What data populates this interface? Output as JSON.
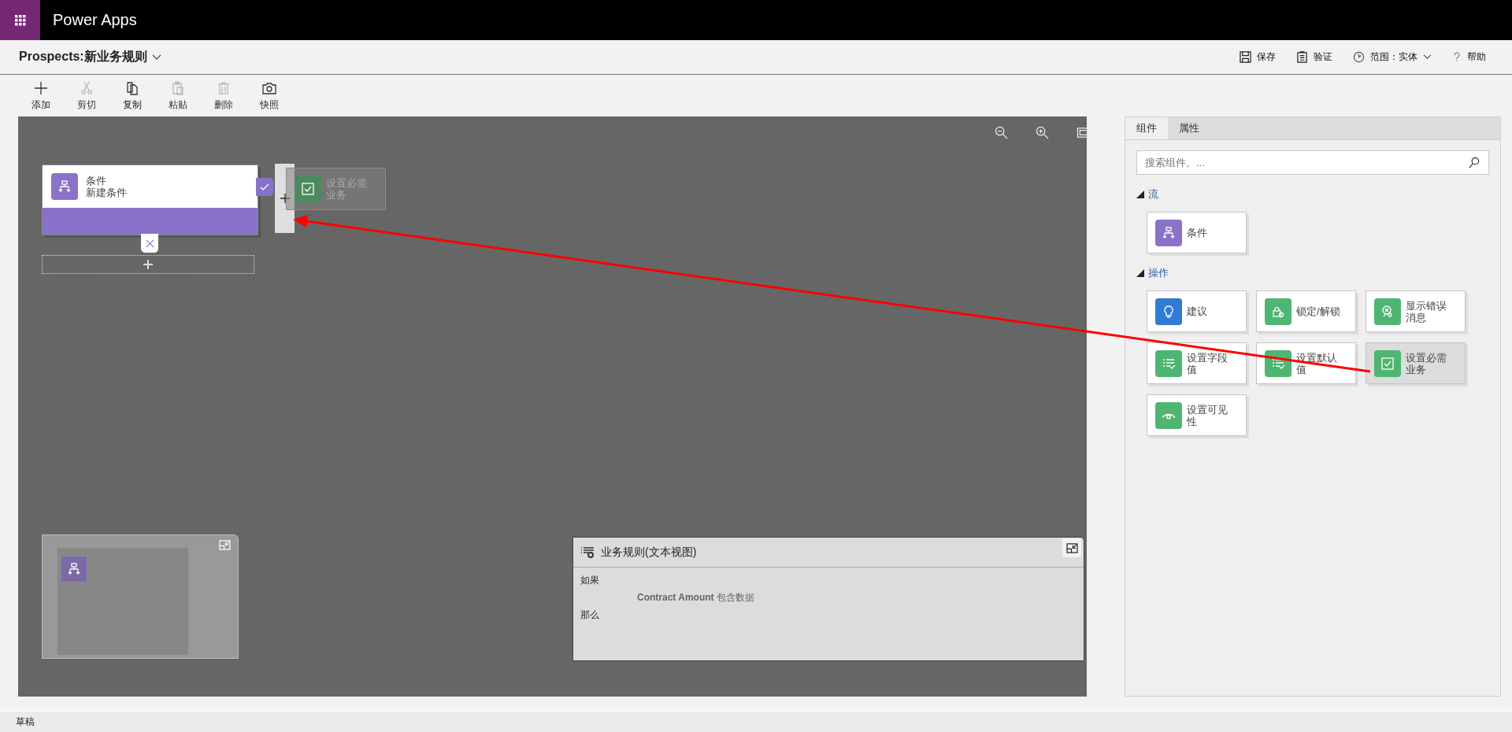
{
  "app": {
    "title": "Power Apps"
  },
  "header": {
    "title": "Prospects:新业务规则",
    "actions": [
      {
        "kind": "save",
        "label": "保存"
      },
      {
        "kind": "validate",
        "label": "验证"
      },
      {
        "kind": "scope",
        "label": "范围：",
        "value": "实体"
      },
      {
        "kind": "help",
        "label": "帮助"
      }
    ]
  },
  "toolbar": [
    {
      "kind": "add",
      "label": "添加",
      "disabled": false
    },
    {
      "kind": "cut",
      "label": "剪切",
      "disabled": true
    },
    {
      "kind": "copy",
      "label": "复制",
      "disabled": false
    },
    {
      "kind": "paste",
      "label": "粘贴",
      "disabled": true
    },
    {
      "kind": "delete",
      "label": "删除",
      "disabled": true
    },
    {
      "kind": "snapshot",
      "label": "快照",
      "disabled": false
    }
  ],
  "canvas": {
    "condition_node": {
      "title": "条件",
      "subtitle": "新建条件"
    },
    "drag_preview": {
      "label": "设置必需业务"
    }
  },
  "text_view": {
    "title": "业务规则(文本视图)",
    "lines": [
      {
        "kind": "keyword",
        "text": "如果"
      },
      {
        "kind": "clause",
        "text": "**Contract Amount** 包含数据"
      },
      {
        "kind": "keyword",
        "text": "那么"
      }
    ]
  },
  "panel": {
    "tabs": [
      {
        "label": "组件",
        "selected": true
      },
      {
        "label": "属性",
        "selected": false
      }
    ],
    "search": {
      "placeholder": "搜索组件。..."
    },
    "sections": [
      {
        "title": "流",
        "expanded": true,
        "items": [
          {
            "kind": "condition",
            "label": "条件",
            "color": "#8b72c9",
            "selected": false
          }
        ]
      },
      {
        "title": "操作",
        "expanded": true,
        "items": [
          {
            "kind": "bulb",
            "label": "建议",
            "color": "#2f7bd6",
            "selected": false
          },
          {
            "kind": "lock",
            "label": "锁定/解锁",
            "color": "#4fb572",
            "selected": false
          },
          {
            "kind": "error",
            "label": "显示错误消息",
            "color": "#4fb572",
            "selected": false
          },
          {
            "kind": "fieldlist",
            "label": "设置字段值",
            "color": "#4fb572",
            "selected": false
          },
          {
            "kind": "fieldlist",
            "label": "设置默认值",
            "color": "#4fb572",
            "selected": false
          },
          {
            "kind": "checkbox",
            "label": "设置必需业务",
            "color": "#4fb572",
            "selected": true
          },
          {
            "kind": "eye",
            "label": "设置可见性",
            "color": "#4fb572",
            "selected": false
          }
        ]
      }
    ]
  },
  "status_bar": {
    "text": "草稿"
  }
}
